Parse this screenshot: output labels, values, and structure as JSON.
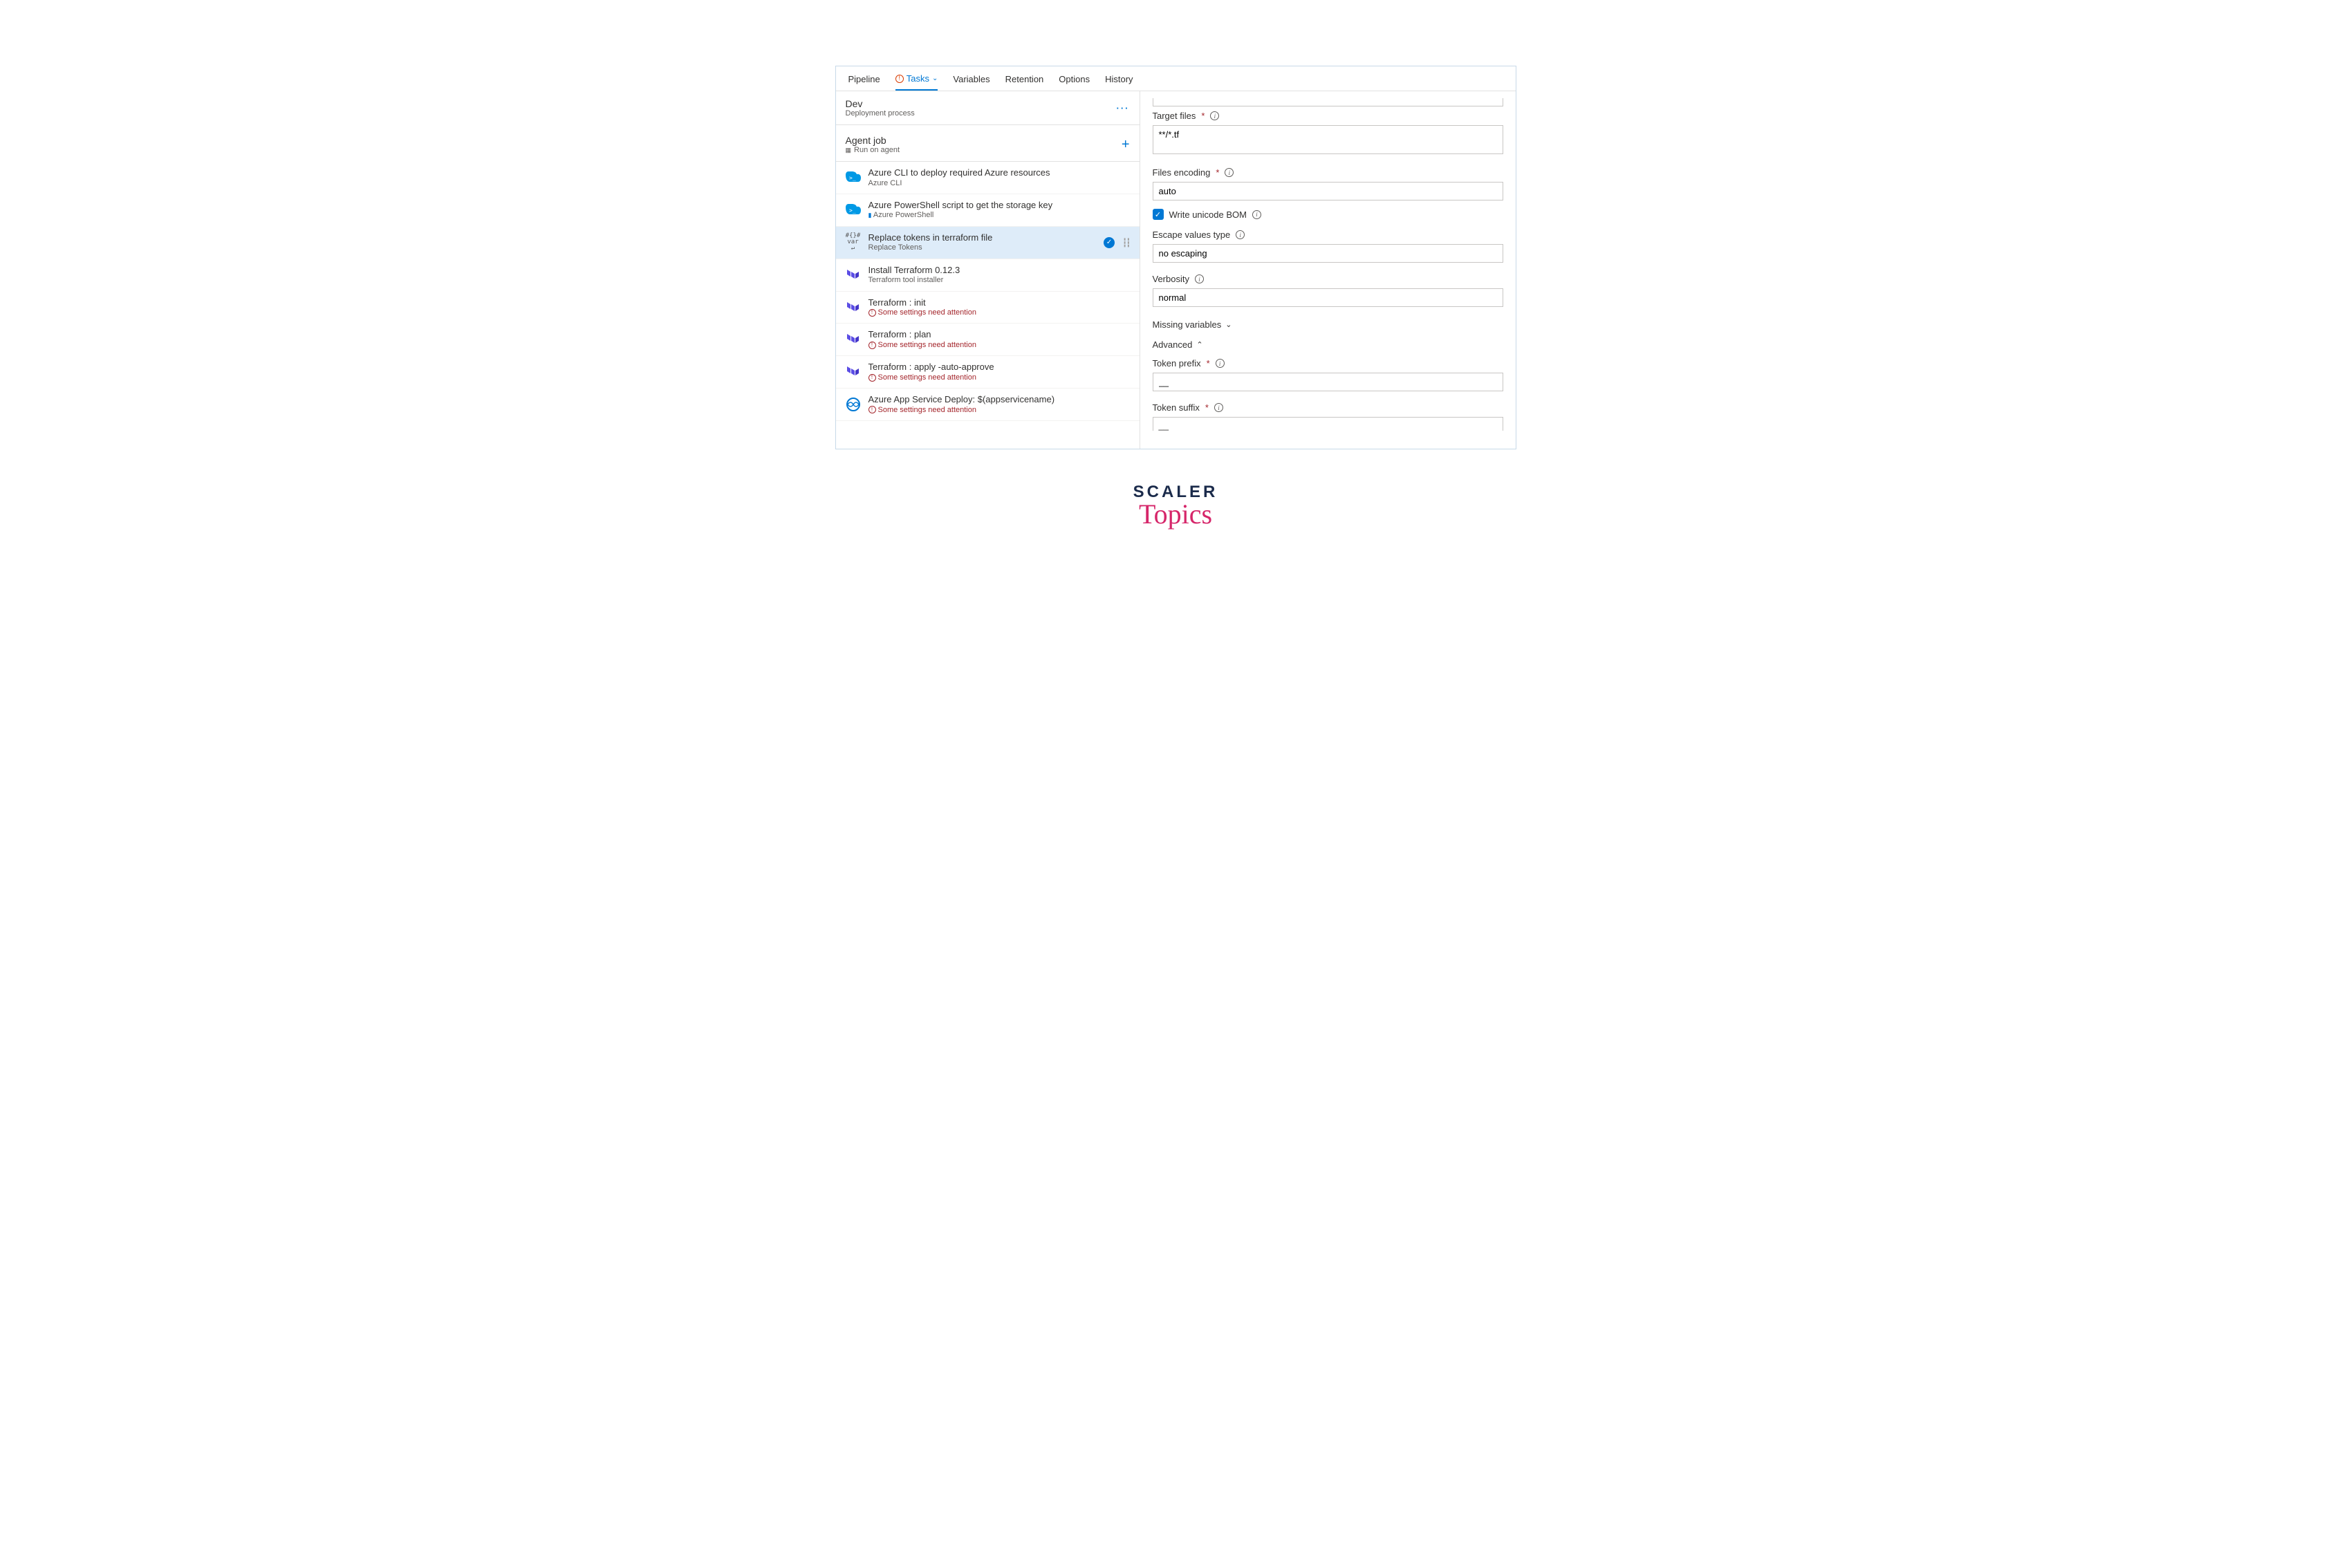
{
  "nav": {
    "tabs": {
      "pipeline": "Pipeline",
      "tasks": "Tasks",
      "variables": "Variables",
      "retention": "Retention",
      "options": "Options",
      "history": "History"
    }
  },
  "stage": {
    "name": "Dev",
    "subtitle": "Deployment process"
  },
  "agent": {
    "title": "Agent job",
    "subtitle": "Run on agent"
  },
  "tasks": [
    {
      "title": "Azure CLI to deploy required Azure resources",
      "sub": "Azure CLI",
      "icon": "azure-cli",
      "warn": false,
      "selected": false
    },
    {
      "title": "Azure PowerShell script to get the storage key",
      "sub": "Azure PowerShell",
      "icon": "powershell",
      "warn": false,
      "selected": false
    },
    {
      "title": "Replace tokens in terraform file",
      "sub": "Replace Tokens",
      "icon": "replace-tokens",
      "warn": false,
      "selected": true
    },
    {
      "title": "Install Terraform 0.12.3",
      "sub": "Terraform tool installer",
      "icon": "terraform",
      "warn": false,
      "selected": false
    },
    {
      "title": "Terraform : init",
      "sub": "Some settings need attention",
      "icon": "terraform",
      "warn": true,
      "selected": false
    },
    {
      "title": "Terraform : plan",
      "sub": "Some settings need attention",
      "icon": "terraform",
      "warn": true,
      "selected": false
    },
    {
      "title": "Terraform : apply -auto-approve",
      "sub": "Some settings need attention",
      "icon": "terraform",
      "warn": true,
      "selected": false
    },
    {
      "title": "Azure App Service Deploy: $(appservicename)",
      "sub": "Some settings need attention",
      "icon": "appservice",
      "warn": true,
      "selected": false
    }
  ],
  "form": {
    "target_files_label": "Target files",
    "target_files_value": "**/*.tf",
    "files_encoding_label": "Files encoding",
    "files_encoding_value": "auto",
    "write_bom_label": "Write unicode BOM",
    "escape_label": "Escape values type",
    "escape_value": "no escaping",
    "verbosity_label": "Verbosity",
    "verbosity_value": "normal",
    "missing_vars_label": "Missing variables",
    "advanced_label": "Advanced",
    "token_prefix_label": "Token prefix",
    "token_prefix_value": "__",
    "token_suffix_label": "Token suffix",
    "token_suffix_value": "__"
  },
  "logo": {
    "line1": "SCALER",
    "line2": "Topics"
  }
}
